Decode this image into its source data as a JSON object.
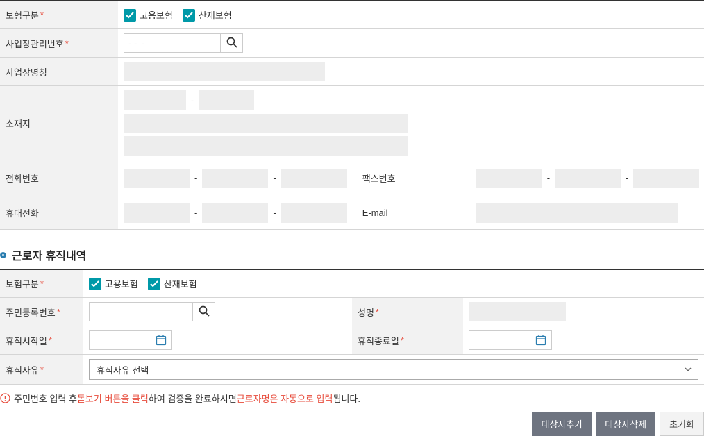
{
  "top": {
    "insurance_type_label": "보험구분",
    "emp_insurance": "고용보험",
    "ind_insurance": "산재보험",
    "biz_mgmt_no_label": "사업장관리번호",
    "biz_mgmt_no_placeholder": "- -  -",
    "biz_name_label": "사업장명칭",
    "location_label": "소재지",
    "phone_label": "전화번호",
    "fax_label": "팩스번호",
    "mobile_label": "휴대전화",
    "email_label": "E-mail"
  },
  "section2": {
    "title": "근로자 휴직내역",
    "insurance_type_label": "보험구분",
    "emp_insurance": "고용보험",
    "ind_insurance": "산재보험",
    "rrn_label": "주민등록번호",
    "name_label": "성명",
    "start_label": "휴직시작일",
    "end_label": "휴직종료일",
    "reason_label": "휴직사유",
    "reason_placeholder": "휴직사유 선택"
  },
  "info": {
    "p1": "주민번호 입력 후 ",
    "p2": "돋보기 버튼을 클릭",
    "p3": "하여 검증을 완료하시면 ",
    "p4": "근로자명은 자동으로 입력",
    "p5": "됩니다."
  },
  "buttons": {
    "add": "대상자추가",
    "delete": "대상자삭제",
    "reset": "초기화"
  }
}
